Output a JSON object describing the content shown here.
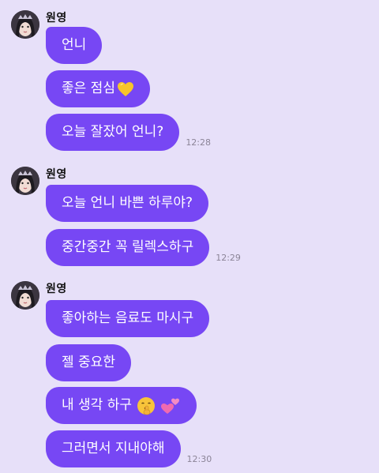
{
  "colors": {
    "background": "#e7e0f9",
    "bubble": "#7747f4",
    "bubble_text": "#ffffff",
    "timestamp": "#8b8497"
  },
  "groups": [
    {
      "sender": "원영",
      "time": "12:28",
      "messages": [
        {
          "text": "언니"
        },
        {
          "text": "좋은 점심",
          "emoji": "yellow-heart-icon"
        },
        {
          "text": "오늘 잘잤어 언니?"
        }
      ]
    },
    {
      "sender": "원영",
      "time": "12:29",
      "messages": [
        {
          "text": "오늘 언니 바쁜 하루야?"
        },
        {
          "text": "중간중간 꼭 릴렉스하구"
        }
      ]
    },
    {
      "sender": "원영",
      "time": "12:30",
      "messages": [
        {
          "text": "좋아하는 음료도 마시구"
        },
        {
          "text": "젤 중요한"
        },
        {
          "text": "내 생각 하구",
          "emoji": "shushing-face-icon two-hearts-icon"
        },
        {
          "text": "그러면서 지내야해"
        }
      ]
    }
  ]
}
